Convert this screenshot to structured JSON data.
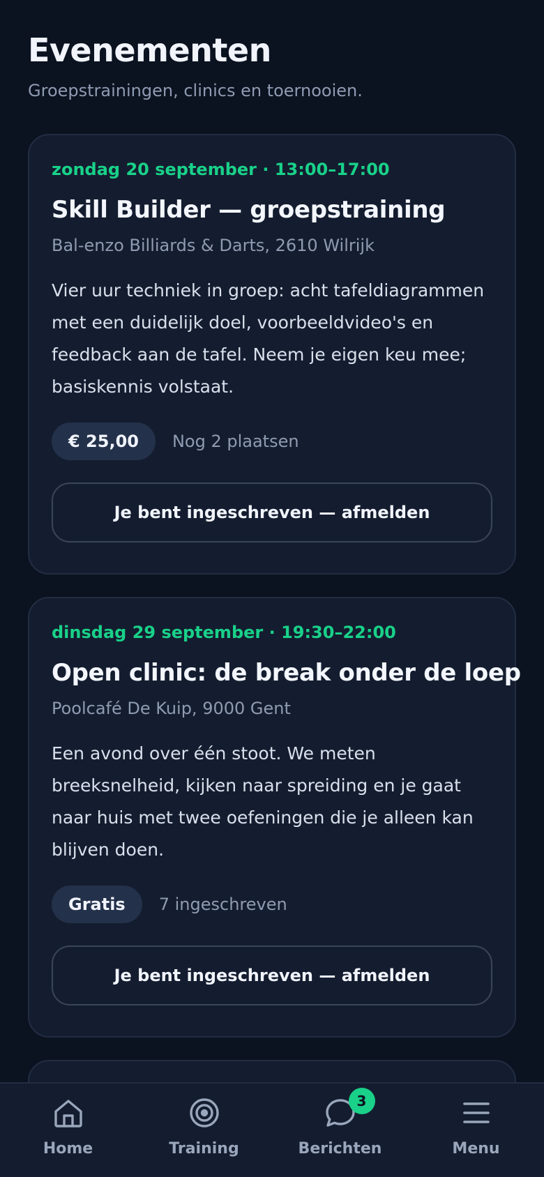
{
  "header": {
    "title": "Evenementen",
    "subtitle": "Groepstrainingen, clinics en toernooien."
  },
  "events": [
    {
      "date": "zondag 20 september · 13:00–17:00",
      "title": "Skill Builder — groepstraining",
      "location": "Bal-enzo Billiards & Darts, 2610 Wilrijk",
      "description": "Vier uur techniek in groep: acht tafeldiagrammen met een duidelijk doel, voorbeeldvideo's en feedback aan de tafel. Neem je eigen keu mee; basiskennis volstaat.",
      "price": "€ 25,00",
      "availability": "Nog 2 plaatsen",
      "action_label": "Je bent ingeschreven — afmelden"
    },
    {
      "date": "dinsdag 29 september · 19:30–22:00",
      "title": "Open clinic: de break onder de loep",
      "location": "Poolcafé De Kuip, 9000 Gent",
      "description": "Een avond over één stoot. We meten breeksnelheid, kijken naar spreiding en je gaat naar huis met twee oefeningen die je alleen kan blijven doen.",
      "price": "Gratis",
      "availability": "7 ingeschreven",
      "action_label": "Je bent ingeschreven — afmelden"
    }
  ],
  "nav": {
    "items": [
      {
        "label": "Home",
        "icon": "home-icon"
      },
      {
        "label": "Training",
        "icon": "target-icon"
      },
      {
        "label": "Berichten",
        "icon": "chat-icon",
        "badge": "3"
      },
      {
        "label": "Menu",
        "icon": "menu-icon"
      }
    ]
  },
  "colors": {
    "background": "#0b1220",
    "card": "#141d2f",
    "accent": "#19d189",
    "muted_text": "#8f9bb2"
  }
}
